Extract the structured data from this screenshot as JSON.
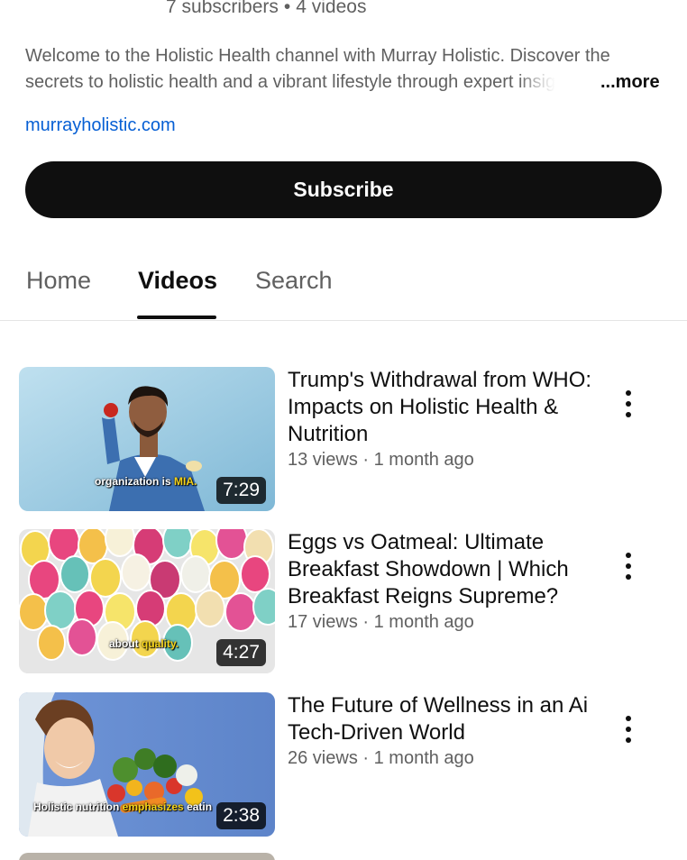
{
  "channel": {
    "subscribers": "7 subscribers",
    "separator": "•",
    "videos_count": "4 videos",
    "description_line1": "Welcome to the Holistic Health channel with Murray Holistic. Discover the",
    "description_line2": "secrets to holistic health and a vibrant lifestyle through expert",
    "description_fade": "insig",
    "more_label": "...more",
    "link": "murrayholistic.com",
    "subscribe_label": "Subscribe"
  },
  "tabs": [
    {
      "label": "Home",
      "active": false
    },
    {
      "label": "Videos",
      "active": true
    },
    {
      "label": "Search",
      "active": false
    }
  ],
  "videos": [
    {
      "title": "Trump's Withdrawal from WHO: Impacts on Holistic Health & Nutrition",
      "views": "13 views",
      "age": "1 month ago",
      "duration": "7:29",
      "caption_plain": "organization is",
      "caption_highlight": "MIA.",
      "menu_icon": "more-vert-icon"
    },
    {
      "title": "Eggs vs Oatmeal: Ultimate Breakfast Showdown | Which Breakfast Reigns Supreme?",
      "views": "17 views",
      "age": "1 month ago",
      "duration": "4:27",
      "caption_plain": "about",
      "caption_highlight": "quality.",
      "menu_icon": "more-vert-icon"
    },
    {
      "title": "The Future of Wellness in an Ai Tech-Driven World",
      "views": "26 views",
      "age": "1 month ago",
      "duration": "2:38",
      "caption_plain": "Holistic nutrition",
      "caption_highlight": "emphasizes",
      "caption_tail": "eatin",
      "menu_icon": "more-vert-icon"
    }
  ],
  "meta_separator": "·",
  "colors": {
    "accent_link": "#065fd4",
    "subscribe_bg": "#0f0f0f",
    "secondary_text": "#606060",
    "caption_highlight": "#f5d31a"
  }
}
